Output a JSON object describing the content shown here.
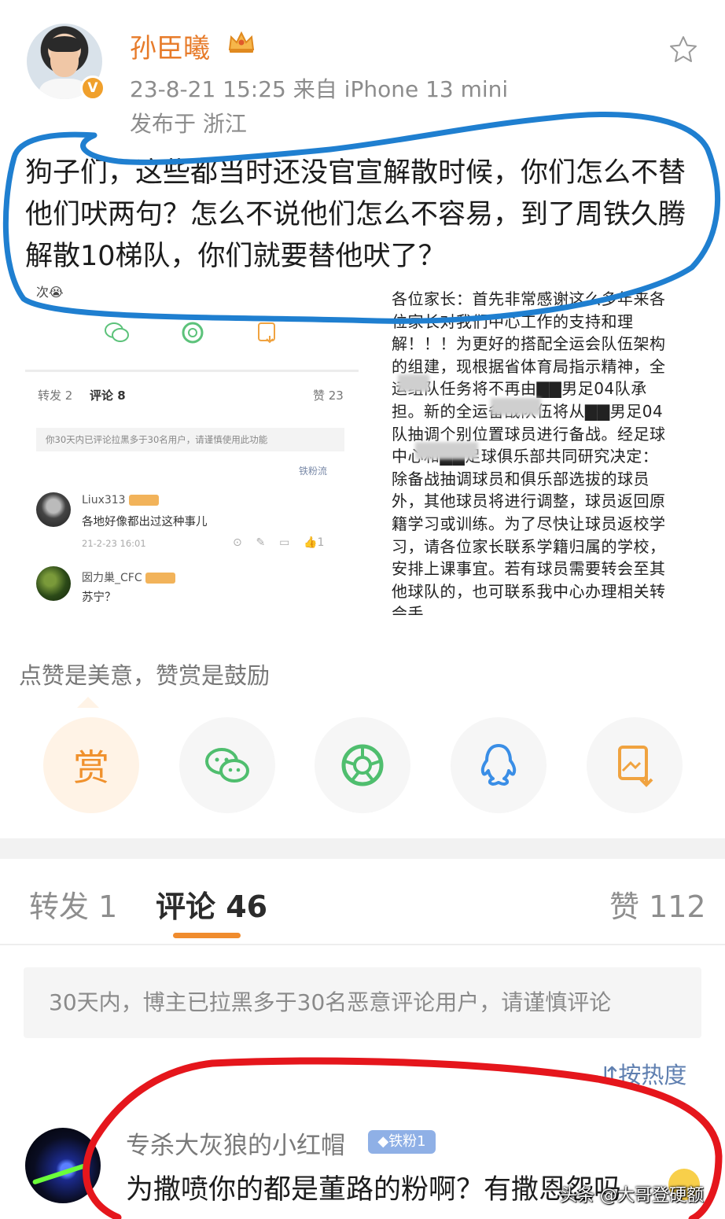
{
  "post": {
    "author": "孙臣曦",
    "meta": "23-8-21 15:25  来自 iPhone 13 mini",
    "location": "发布于 浙江",
    "text": "狗子们，这些都当时还没官宣解散时候，你们怎么不替他们吠两句？怎么不说他们怎么不容易，到了周铁久腾解散10梯队，你们就要替他吠了？"
  },
  "embedded_screenshot": {
    "fragment": "次😭",
    "tabs": {
      "reposts": "转发 2",
      "comments": "评论 8",
      "likes": "赞 23"
    },
    "notice": "你30天内已评论拉黑多于30名用户，请谨慎使用此功能",
    "sort": "铁粉流",
    "comments": [
      {
        "name": "Liux313",
        "text": "各地好像都出过这种事儿",
        "time": "21-2-23 16:01",
        "likes": "1"
      },
      {
        "name": "囡力巢_CFC",
        "text": "苏宁？"
      }
    ],
    "notice_doc": "各位家长：首先非常感谢这么多年来各位家长对我们中心工作的支持和理解！！！为更好的搭配全运会队伍架构的组建，现根据省体育局指示精神，全运组队任务将不再由▇▇男足04队承担。新的全运备战队伍将从▇▇男足04队抽调个别位置球员进行备战。经足球中心和▇▇足球俱乐部共同研究决定：除备战抽调球员和俱乐部选拔的球员外，其他球员将进行调整，球员返回原籍学习或训练。为了尽快让球员返校学习，请各位家长联系学籍归属的学校，安排上课事宜。若有球员需要转会至其他球队的，也可联系我中心办理相关转会手"
  },
  "reward": {
    "hint": "点赞是美意，赞赏是鼓励",
    "button_label": "赏"
  },
  "share_icons": [
    "wechat-icon",
    "moments-icon",
    "qq-icon",
    "save-image-icon"
  ],
  "tabs": {
    "reposts": "转发 1",
    "comments": "评论 46",
    "likes": "赞 112"
  },
  "block_notice": "30天内，博主已拉黑多于30名恶意评论用户，请谨慎评论",
  "sort_toggle": "按热度",
  "comment": {
    "name": "专杀大灰狼的小红帽",
    "badge": "铁粉1",
    "text": "为撒喷你的都是董路的粉啊？有撒恩怨吗"
  },
  "watermark": "头条 @大哥登硬额",
  "colors": {
    "accent_orange": "#f08c2e",
    "link_blue": "#5f7fb0",
    "highlight_blue": "#1f7fd0",
    "highlight_red": "#e5161c"
  }
}
